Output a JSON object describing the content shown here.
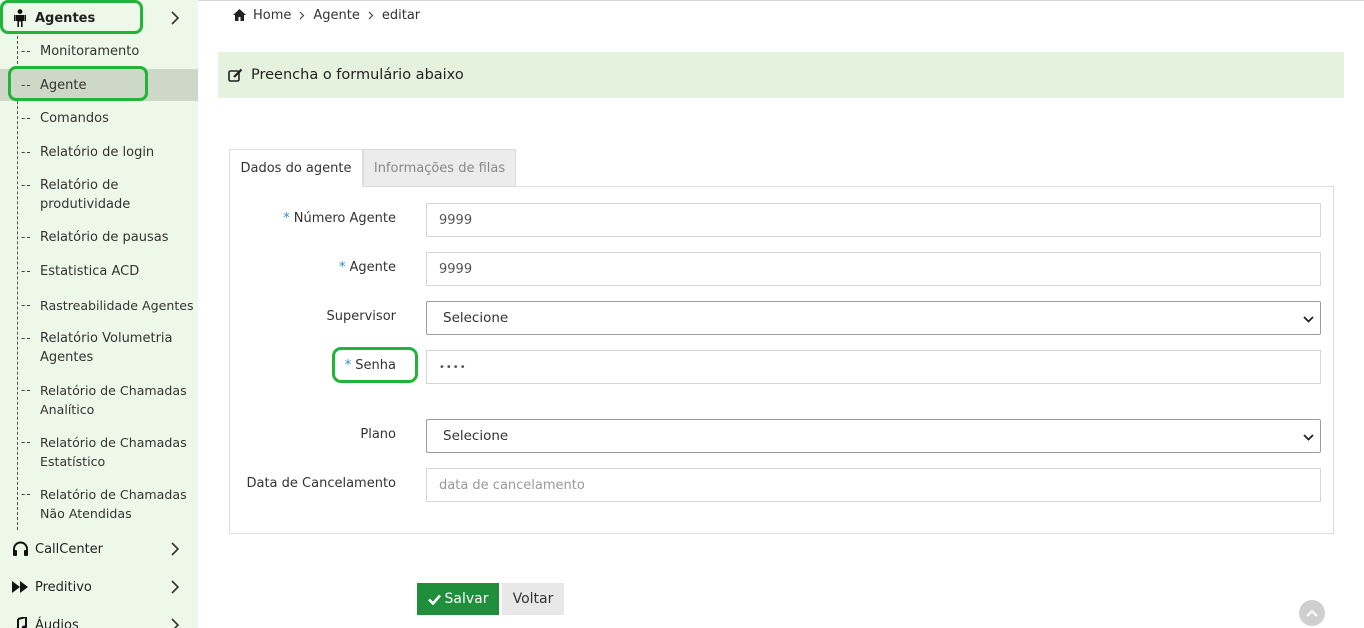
{
  "sidebar": {
    "agentes_label": "Agentes",
    "items": [
      {
        "label": "Monitoramento"
      },
      {
        "label": "Agente"
      },
      {
        "label": "Comandos"
      },
      {
        "label": "Relatório de login"
      },
      {
        "label": "Relatório de produtividade"
      },
      {
        "label": "Relatório de pausas"
      },
      {
        "label": "Estatistica ACD"
      },
      {
        "label": "Rastreabilidade Agentes"
      },
      {
        "label": "Relatório Volumetria Agentes"
      },
      {
        "label": "Relatório de Chamadas Analítico"
      },
      {
        "label": "Relatório de Chamadas Estatístico"
      },
      {
        "label": "Relatório de Chamadas Não Atendidas"
      }
    ],
    "active_item": "Agente",
    "callcenter_label": "CallCenter",
    "preditivo_label": "Preditivo",
    "audios_label": "Áudios"
  },
  "breadcrumb": {
    "home": "Home",
    "agente": "Agente",
    "current": "editar"
  },
  "panel": {
    "title": "Preencha o formulário abaixo"
  },
  "tabs": {
    "dados": "Dados do agente",
    "filas": "Informações de filas",
    "active": "Dados do agente"
  },
  "form": {
    "numero_agente": {
      "label": "Número Agente",
      "required": "*",
      "value": "9999"
    },
    "agente": {
      "label": "Agente",
      "required": "*",
      "value": "9999"
    },
    "supervisor": {
      "label": "Supervisor",
      "value": "Selecione"
    },
    "senha": {
      "label": "Senha",
      "required": "*",
      "value": "••••"
    },
    "plano": {
      "label": "Plano",
      "value": "Selecione"
    },
    "data_cancelamento": {
      "label": "Data de Cancelamento",
      "placeholder": "data de cancelamento"
    }
  },
  "buttons": {
    "salvar": "Salvar",
    "voltar": "Voltar"
  },
  "colors": {
    "sidebar_bg": "#eef8e8",
    "panel_head_bg": "#e5f3de",
    "primary_green": "#1f8f3c",
    "highlight_green": "#22b33a",
    "required_blue": "#2d8ac7"
  },
  "icons": {
    "agentes": "person-icon",
    "callcenter": "headset-icon",
    "preditivo": "fast-forward-icon",
    "audios": "music-note-icon",
    "home": "home-icon",
    "panel": "edit-icon",
    "salvar": "check-icon",
    "scroll_top": "chevron-up-icon"
  }
}
